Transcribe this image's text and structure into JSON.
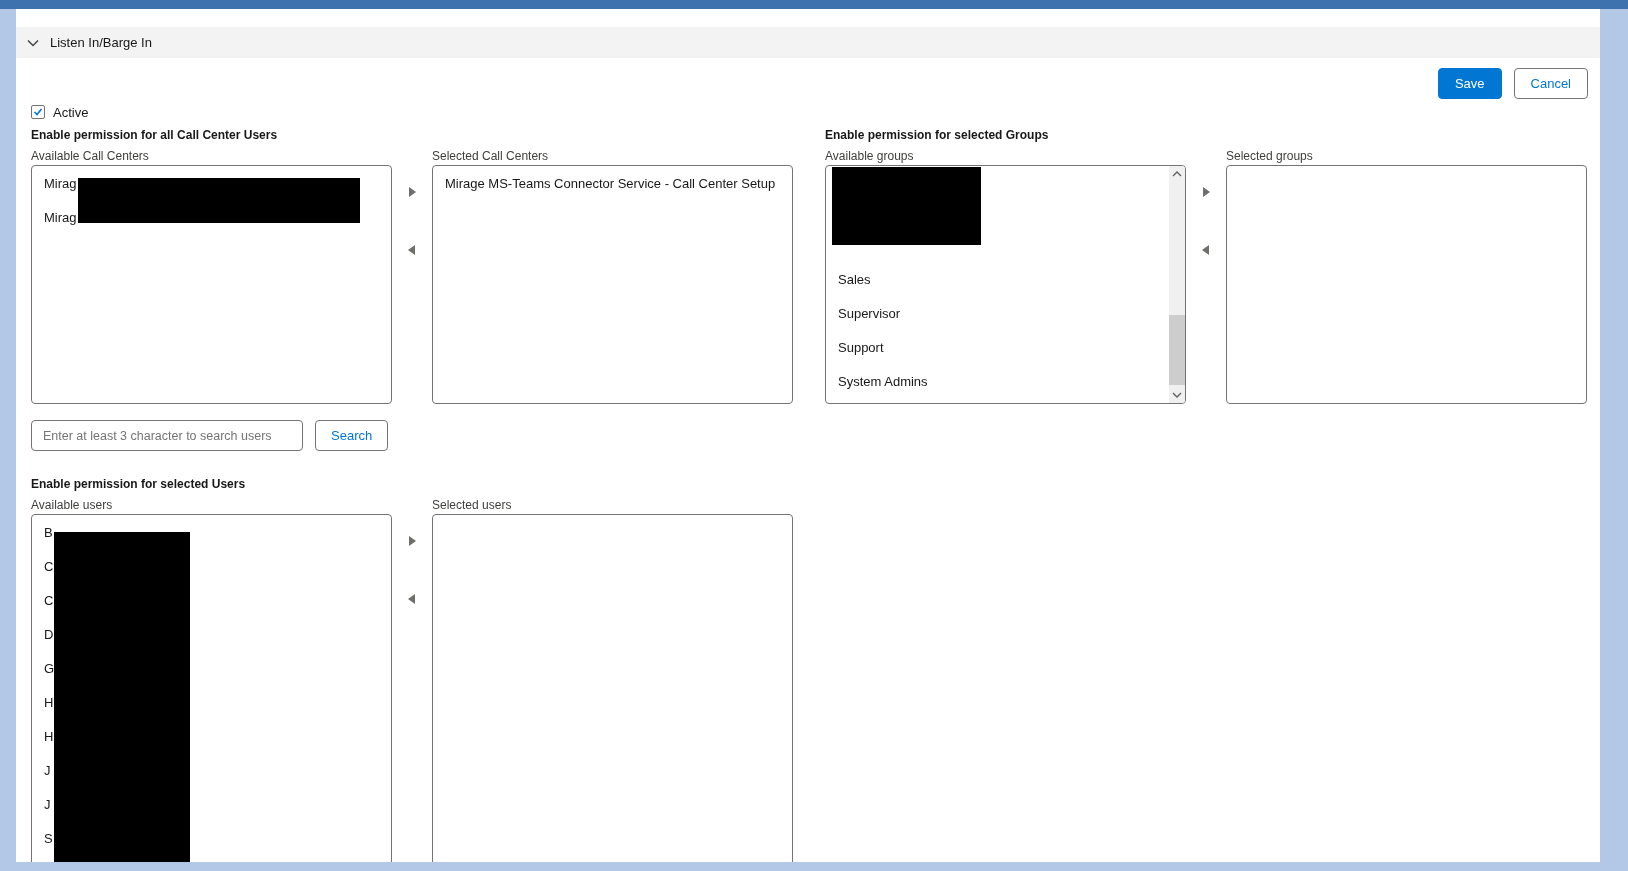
{
  "section": {
    "title": "Listen In/Barge In",
    "expanded": true
  },
  "buttons": [
    {
      "label": "Save",
      "kind": "primary"
    },
    {
      "label": "Cancel",
      "kind": "neutral"
    }
  ],
  "active": {
    "label": "Active",
    "checked": true
  },
  "call_centers": {
    "heading": "Enable permission for all Call Center Users",
    "available": {
      "label": "Available Call Centers",
      "items": [
        "Mirag",
        "Mirag"
      ],
      "redacted": true
    },
    "selected": {
      "label": "Selected Call Centers",
      "items": [
        "Mirage MS-Teams Connector Service - Call Center Setup"
      ]
    }
  },
  "user_search": {
    "placeholder": "Enter at least 3 character to search users",
    "button": "Search"
  },
  "groups": {
    "heading": "Enable permission for selected Groups",
    "available": {
      "label": "Available groups",
      "items": [
        "Sales",
        "Supervisor",
        "Support",
        "System Admins"
      ],
      "redacted": true,
      "scrollable": true
    },
    "selected": {
      "label": "Selected groups"
    }
  },
  "users": {
    "heading": "Enable permission for selected Users",
    "available": {
      "label": "Available users",
      "items": [
        "B",
        "C",
        "C",
        "D",
        "G",
        "H",
        "H",
        "J",
        "J",
        "S"
      ],
      "redacted": true
    },
    "selected": {
      "label": "Selected users"
    }
  }
}
